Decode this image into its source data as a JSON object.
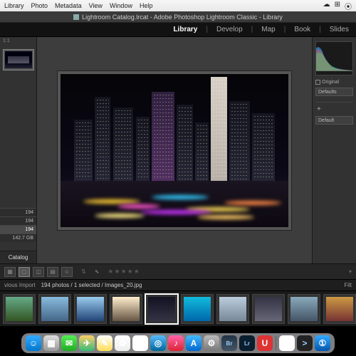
{
  "mac_menu": {
    "items": [
      "Library",
      "Photo",
      "Metadata",
      "View",
      "Window",
      "Help"
    ]
  },
  "window": {
    "title": "Lightroom Catalog.lrcat - Adobe Photoshop Lightroom Classic - Library"
  },
  "modules": {
    "items": [
      "Library",
      "Develop",
      "Map",
      "Book",
      "Slides"
    ],
    "active": 0
  },
  "left_panel": {
    "counts": [
      "194",
      "194",
      "194"
    ],
    "size_line": "142.7 GB",
    "catalog_btn": "Catalog"
  },
  "right_panel": {
    "original_label": "Original",
    "defaults": "Defaults",
    "defaults2": "Default",
    "plus": "+"
  },
  "toolbar": {
    "views": [
      "grid",
      "loupe",
      "compare",
      "survey",
      "people"
    ]
  },
  "filmstrip_status": {
    "left": "vious Import",
    "mid": "194 photos / 1 selected / Images_20.jpg",
    "right": "Filt"
  },
  "thumbnails": [
    {
      "bg": "linear-gradient(#6a8,#352)"
    },
    {
      "bg": "linear-gradient(#8bd,#468)"
    },
    {
      "bg": "linear-gradient(#9ce,#247)"
    },
    {
      "bg": "linear-gradient(#fec,#654)"
    },
    {
      "bg": "linear-gradient(#112,#334)",
      "sel": true
    },
    {
      "bg": "linear-gradient(#1bd,#06a)"
    },
    {
      "bg": "linear-gradient(#bcd,#789)"
    },
    {
      "bg": "linear-gradient(#334,#667)"
    },
    {
      "bg": "linear-gradient(#8ab,#456)"
    },
    {
      "bg": "linear-gradient(#c94,#733)"
    },
    {
      "bg": "linear-gradient(#9cf,#47a)"
    },
    {
      "bg": "linear-gradient(#1cd,#068)"
    }
  ],
  "dock": [
    {
      "name": "finder",
      "bg": "linear-gradient(#3af,#07c)",
      "glyph": "☺"
    },
    {
      "name": "launchpad",
      "bg": "linear-gradient(#ddd,#999)",
      "glyph": "▦"
    },
    {
      "name": "messages",
      "bg": "linear-gradient(#5e5,#2a2)",
      "glyph": "✉"
    },
    {
      "name": "maps",
      "bg": "linear-gradient(#fc6,#3b7)",
      "glyph": "✈"
    },
    {
      "name": "notes",
      "bg": "linear-gradient(#fff,#fd5)",
      "glyph": "✎"
    },
    {
      "name": "photos",
      "bg": "linear-gradient(#fff,#eee)",
      "glyph": "✿"
    },
    {
      "name": "reminders",
      "bg": "#fff",
      "glyph": "☰"
    },
    {
      "name": "safari",
      "bg": "linear-gradient(#5bf,#069)",
      "glyph": "◎"
    },
    {
      "name": "music",
      "bg": "linear-gradient(#f6a,#d23)",
      "glyph": "♪"
    },
    {
      "name": "appstore",
      "bg": "linear-gradient(#4bf,#06c)",
      "glyph": "A"
    },
    {
      "name": "preferences",
      "bg": "linear-gradient(#bbb,#777)",
      "glyph": "⚙"
    },
    {
      "name": "bridge",
      "bg": "linear-gradient(#234,#456)",
      "glyph": "Br"
    },
    {
      "name": "lightroom",
      "bg": "#0a1e2e",
      "glyph": "Lr"
    },
    {
      "name": "magnet",
      "bg": "#d33",
      "glyph": "U"
    },
    {
      "name": "chrome",
      "bg": "#fff",
      "glyph": "◉"
    },
    {
      "name": "terminal",
      "bg": "#222",
      "glyph": ">"
    },
    {
      "name": "1password",
      "bg": "linear-gradient(#3af,#05a)",
      "glyph": "①"
    }
  ]
}
